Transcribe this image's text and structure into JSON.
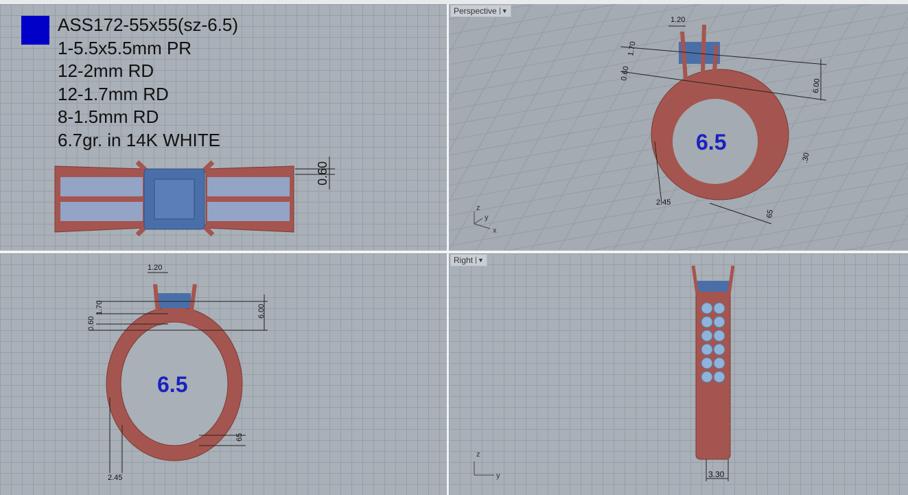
{
  "viewports": {
    "top": {
      "notes": [
        "ASS172-55x55(sz-6.5)",
        "1-5.5x5.5mm PR",
        "12-2mm RD",
        "12-1.7mm RD",
        "8-1.5mm RD",
        "6.7gr. in 14K WHITE"
      ],
      "swatch_color": "#0000C8",
      "dims": {
        "d060": "0.60"
      }
    },
    "perspective": {
      "label": "Perspective",
      "dims": {
        "d120": "1.20",
        "d170": "1.70",
        "d060": "0.60",
        "d600": "6.00",
        "d245": "2.45",
        "d65": "65",
        "d30": ".30"
      },
      "size_text": "6.5",
      "axes": {
        "z": "z",
        "y": "y",
        "x": "x"
      }
    },
    "front": {
      "dims": {
        "d120": "1.20",
        "d170": "1.70",
        "d060": "0.60",
        "d600": "6.00",
        "d65": "65",
        "d245": "2.45"
      },
      "size_text": "6.5"
    },
    "right": {
      "label": "Right",
      "dims": {
        "d330": "3.30"
      },
      "axes": {
        "z": "z",
        "y": "y"
      }
    }
  },
  "colors": {
    "metal": "#A5554F",
    "stone": "#4A6FA8",
    "side_stone": "#8FB3DA",
    "size_text": "#1A22C0"
  }
}
